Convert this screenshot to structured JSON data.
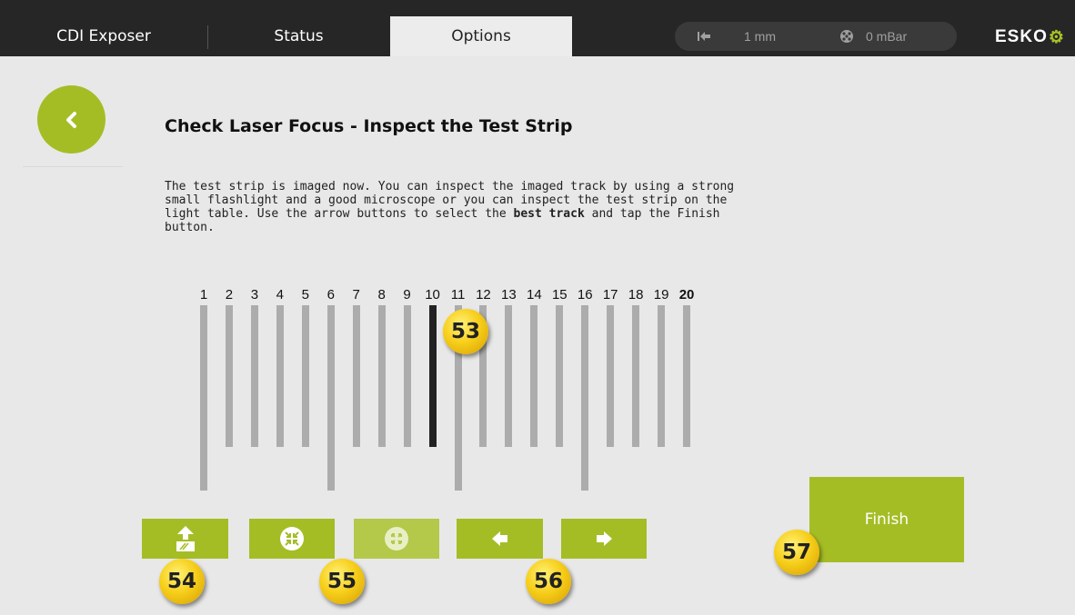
{
  "header": {
    "tabs": [
      {
        "label": "CDI Exposer",
        "active": false
      },
      {
        "label": "Status",
        "active": false
      },
      {
        "label": "Options",
        "active": true
      }
    ],
    "status": {
      "distance_icon": "arrow-to-left-icon",
      "distance_value": "1 mm",
      "vacuum_icon": "vacuum-icon",
      "vacuum_value": "0 mBar"
    },
    "brand": "ESKO"
  },
  "page": {
    "back_icon": "chevron-left-icon",
    "title": "Check Laser Focus - Inspect the Test Strip",
    "description_before": "The test strip is imaged now. You can inspect the imaged track by using a strong small flashlight and a good microscope or you can inspect the test strip on the light table. Use the arrow buttons to select the ",
    "description_bold": "best track",
    "description_after": " and tap the Finish button."
  },
  "tracks": {
    "labels": [
      "1",
      "2",
      "3",
      "4",
      "5",
      "6",
      "7",
      "8",
      "9",
      "10",
      "11",
      "12",
      "13",
      "14",
      "15",
      "16",
      "17",
      "18",
      "19",
      "20"
    ],
    "selected_track": "10"
  },
  "buttons": {
    "eject_icon": "eject-strip-icon",
    "focus_in_icon": "focus-collapse-icon",
    "focus_out_icon": "focus-expand-icon",
    "prev_icon": "arrow-left-icon",
    "next_icon": "arrow-right-icon",
    "finish_label": "Finish"
  },
  "callouts": {
    "c53": "53",
    "c54": "54",
    "c55": "55",
    "c56": "56",
    "c57": "57"
  },
  "colors": {
    "accent": "#a5bd25",
    "header_bg": "#262626",
    "background": "#e8e8e8",
    "track": "#acacac",
    "track_selected": "#222222"
  }
}
